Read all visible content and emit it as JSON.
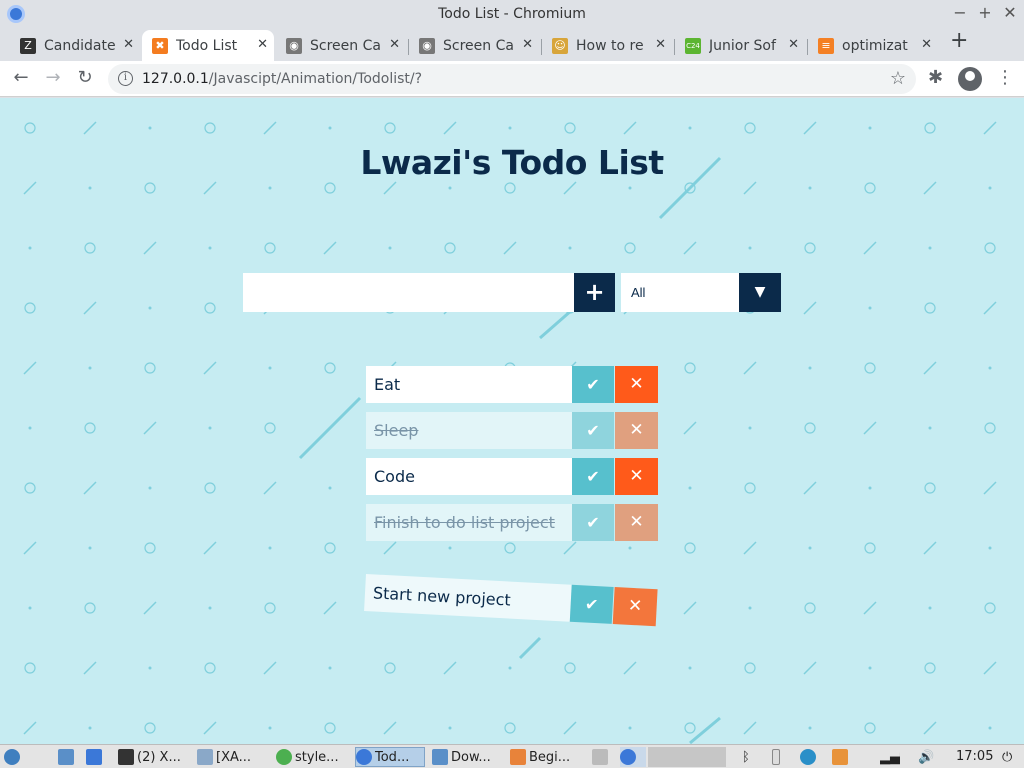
{
  "window": {
    "title": "Todo List - Chromium",
    "controls": [
      "−",
      "+",
      "✕"
    ]
  },
  "tabs": [
    {
      "label": "Candidate",
      "icon": "z-icon",
      "color": "#333333"
    },
    {
      "label": "Todo List",
      "icon": "xampp-icon",
      "color": "#f47c20",
      "active": true
    },
    {
      "label": "Screen Ca",
      "icon": "camera-icon",
      "color": "#777777"
    },
    {
      "label": "Screen Ca",
      "icon": "camera-icon",
      "color": "#777777"
    },
    {
      "label": "How to re",
      "icon": "avatar-icon",
      "color": "#d8a53a"
    },
    {
      "label": "Junior Sof",
      "icon": "c24-icon",
      "color": "#5cb531"
    },
    {
      "label": "optimizat",
      "icon": "stackoverflow-icon",
      "color": "#f48024"
    }
  ],
  "toolbar": {
    "url_host": "127.0.0.1",
    "url_path": "/Javascipt/Animation/Todolist/?"
  },
  "page": {
    "title": "Lwazi's Todo List",
    "input_placeholder": "",
    "add_label": "+",
    "filter_value": "All",
    "filter_arrow": "▼"
  },
  "todos": [
    {
      "text": "Eat",
      "completed": false
    },
    {
      "text": "Sleep",
      "completed": true
    },
    {
      "text": "Code",
      "completed": false
    },
    {
      "text": "Finish to do list project",
      "completed": true
    },
    {
      "text": "Start new project",
      "completed": false,
      "falling": true
    }
  ],
  "taskbar": {
    "items": [
      "(2) X...",
      "[XA...",
      "style...",
      "Tod...",
      "Dow...",
      "Begi..."
    ],
    "clock": "17:05"
  },
  "colors": {
    "page_bg": "#c6ecf2",
    "navy": "#0b2a4a",
    "check": "#57c0cd",
    "trash": "#ff5a1a"
  }
}
